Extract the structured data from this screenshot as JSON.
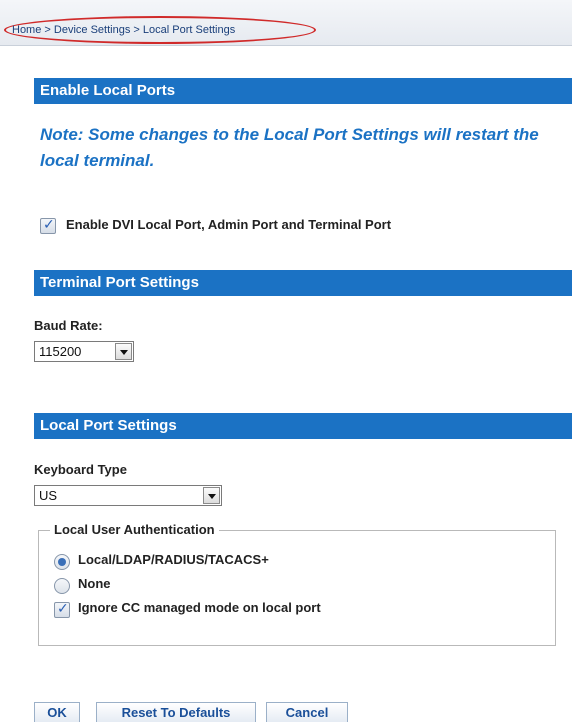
{
  "breadcrumb": {
    "home": "Home",
    "sep1": ">",
    "device_settings": "Device Settings",
    "sep2": ">",
    "current": "Local Port Settings"
  },
  "sections": {
    "enable_local_ports": "Enable Local Ports",
    "terminal_port_settings": "Terminal Port Settings",
    "local_port_settings": "Local Port Settings"
  },
  "note": "Note: Some changes to the Local Port Settings will restart the local terminal.",
  "enable_checkbox": {
    "label": "Enable DVI Local Port, Admin Port and Terminal Port",
    "checked": true
  },
  "baud_rate": {
    "label": "Baud Rate:",
    "value": "115200"
  },
  "keyboard_type": {
    "label": "Keyboard Type",
    "value": "US"
  },
  "local_user_auth": {
    "legend": "Local User Authentication",
    "options": [
      "Local/LDAP/RADIUS/TACACS+",
      "None"
    ],
    "selected": "Local/LDAP/RADIUS/TACACS+",
    "ignore_cc_label": "Ignore CC managed mode on local port",
    "ignore_cc_checked": true
  },
  "buttons": {
    "ok": "OK",
    "reset": "Reset To Defaults",
    "cancel": "Cancel"
  },
  "colors": {
    "section_header_bg": "#1b72c4",
    "note_text": "#1b72c4",
    "breadcrumb_highlight": "#d02a2a"
  }
}
